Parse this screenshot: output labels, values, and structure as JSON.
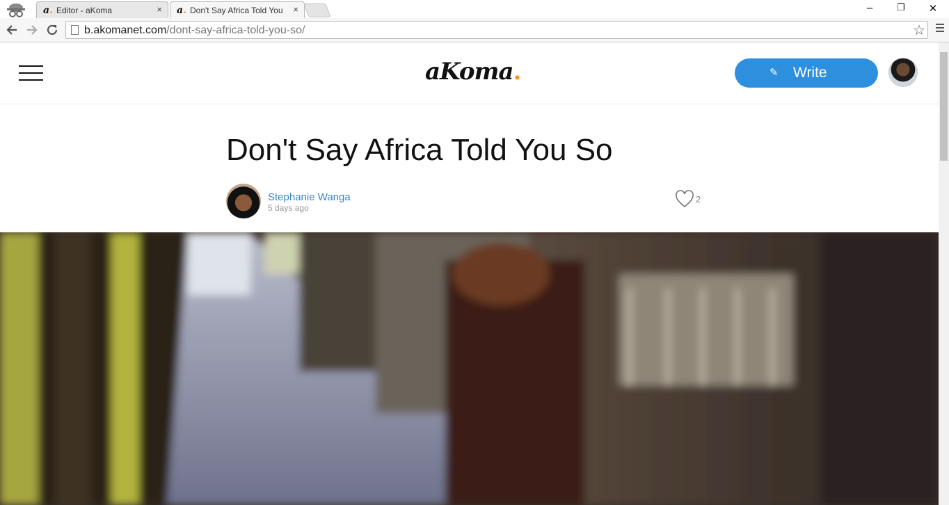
{
  "browser": {
    "tabs": [
      {
        "title": "Editor - aKoma",
        "favicon": "a",
        "close": "×"
      },
      {
        "title": "Don't Say Africa Told You So",
        "favicon": "a",
        "close": "×"
      }
    ],
    "url_domain": "b.akomanet.com",
    "url_path": "/dont-say-africa-told-you-so/",
    "window_controls": [
      "‒",
      "❐",
      "✕"
    ]
  },
  "site": {
    "logo_text": "aKoma",
    "logo_dot": ".",
    "write_label": "Write",
    "accent_color": "#2d8fdd",
    "logo_accent": "#f7941d"
  },
  "article": {
    "title": "Don't Say Africa Told You So",
    "author": "Stephanie Wanga",
    "posted": "5 days ago",
    "likes": "2"
  }
}
